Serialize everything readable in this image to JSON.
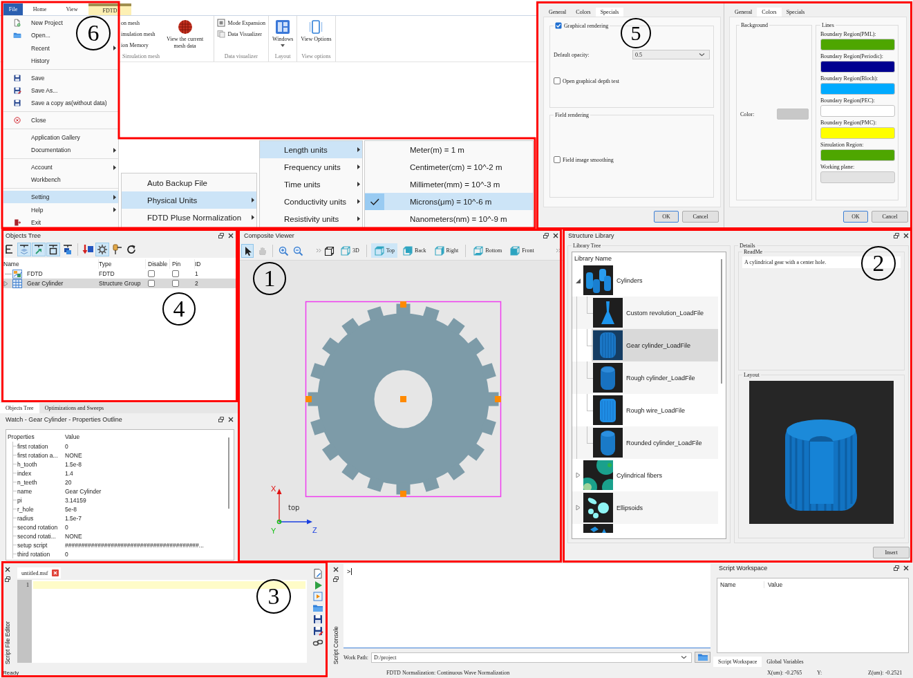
{
  "ribbon": {
    "tabs": [
      {
        "label": "File",
        "selected": true,
        "contextual": false
      },
      {
        "label": "Home",
        "selected": false,
        "contextual": false
      },
      {
        "label": "View",
        "selected": false,
        "contextual": false
      },
      {
        "label": "FDTD",
        "selected": false,
        "contextual": true
      }
    ],
    "groups": [
      {
        "label": "Simulation mesh",
        "items": [
          {
            "kind": "text",
            "label": "on mesh"
          },
          {
            "kind": "text",
            "label": "imulation mesh"
          },
          {
            "kind": "text",
            "label": "ion Memory"
          },
          {
            "kind": "large",
            "label": "View the current mesh data",
            "dropdown": false
          }
        ]
      },
      {
        "label": "Data visualizer",
        "items": [
          {
            "kind": "small",
            "label": "Mode Expansion"
          },
          {
            "kind": "small",
            "label": "Data Visualizer"
          }
        ]
      },
      {
        "label": "Layout",
        "items": [
          {
            "kind": "large",
            "label": "Windows",
            "dropdown": true
          }
        ]
      },
      {
        "label": "View options",
        "items": [
          {
            "kind": "large",
            "label": "View Options",
            "dropdown": false
          }
        ]
      }
    ]
  },
  "file_menu": {
    "sections": [
      {
        "items": [
          {
            "label": "New Project",
            "submenu": false,
            "selected": false
          },
          {
            "label": "Open...",
            "submenu": false,
            "selected": false
          },
          {
            "label": "Recent",
            "submenu": true,
            "selected": false
          },
          {
            "label": "History",
            "submenu": false,
            "selected": false
          }
        ]
      },
      {
        "items": [
          {
            "label": "Save",
            "submenu": false,
            "selected": false
          },
          {
            "label": "Save As...",
            "submenu": false,
            "selected": false
          },
          {
            "label": "Save a copy as(without data)",
            "submenu": false,
            "selected": false
          }
        ]
      },
      {
        "items": [
          {
            "label": "Close",
            "submenu": false,
            "selected": false
          }
        ]
      },
      {
        "items": [
          {
            "label": "Application Gallery",
            "submenu": false,
            "selected": false
          },
          {
            "label": "Documentation",
            "submenu": true,
            "selected": false
          }
        ]
      },
      {
        "items": [
          {
            "label": "Account",
            "submenu": true,
            "selected": false
          },
          {
            "label": "Workbench",
            "submenu": false,
            "selected": false
          }
        ]
      },
      {
        "items": [
          {
            "label": "Setting",
            "submenu": true,
            "selected": true
          },
          {
            "label": "Help",
            "submenu": true,
            "selected": false
          },
          {
            "label": "Exit",
            "submenu": false,
            "selected": false
          }
        ]
      }
    ]
  },
  "setting_menu": {
    "items": [
      {
        "label": "Auto Backup File",
        "submenu": false,
        "selected": false
      },
      {
        "label": "Physical Units",
        "submenu": true,
        "selected": true
      },
      {
        "label": "FDTD Pluse Normalization",
        "submenu": true,
        "selected": false
      }
    ]
  },
  "units_menu": {
    "items": [
      {
        "label": "Length units",
        "submenu": true,
        "selected": true
      },
      {
        "label": "Frequency units",
        "submenu": true,
        "selected": false
      },
      {
        "label": "Time units",
        "submenu": true,
        "selected": false
      },
      {
        "label": "Conductivity units",
        "submenu": true,
        "selected": false
      },
      {
        "label": "Resistivity units",
        "submenu": true,
        "selected": false
      }
    ]
  },
  "length_menu": {
    "items": [
      {
        "label": "Meter(m) = 1 m",
        "checked": false,
        "selected": false
      },
      {
        "label": "Centimeter(cm) = 10^-2 m",
        "checked": false,
        "selected": false
      },
      {
        "label": "Millimeter(mm) = 10^-3 m",
        "checked": false,
        "selected": false
      },
      {
        "label": "Microns(μm) = 10^-6 m",
        "checked": true,
        "selected": true
      },
      {
        "label": "Nanometers(nm) = 10^-9 m",
        "checked": false,
        "selected": false
      }
    ]
  },
  "specials_dialog": {
    "tabs": [
      {
        "label": "General",
        "selected": false
      },
      {
        "label": "Colors",
        "selected": false
      },
      {
        "label": "Specials",
        "selected": true
      }
    ],
    "graphical_rendering": {
      "label": "Graphical rendering",
      "checked": true
    },
    "opacity": {
      "label": "Default opacity:",
      "value": "0.5"
    },
    "depth_test": {
      "label": "Open graphical depth test",
      "checked": false
    },
    "field_rendering": {
      "title": "Field rendering"
    },
    "smoothing": {
      "label": "Field image smoothing",
      "checked": false
    },
    "buttons": [
      {
        "label": "OK",
        "default": true
      },
      {
        "label": "Cancel",
        "default": false
      }
    ]
  },
  "colors_dialog": {
    "tabs": [
      {
        "label": "General",
        "selected": false
      },
      {
        "label": "Colors",
        "selected": true
      },
      {
        "label": "Specials",
        "selected": false
      }
    ],
    "background": {
      "title": "Background",
      "label": "Color:",
      "color": "#c8c8c8"
    },
    "lines": {
      "title": "Lines",
      "items": [
        {
          "label": "Boundary Region(PML):",
          "color": "#4ea600"
        },
        {
          "label": "Boundary Region(Periodic):",
          "color": "#000090"
        },
        {
          "label": "Boundary Region(Bloch):",
          "color": "#00aaff"
        },
        {
          "label": "Boundary Region(PEC):",
          "color": "#ffffff"
        },
        {
          "label": "Boundary Region(PMC):",
          "color": "#ffff00"
        },
        {
          "label": "Simulation Region:",
          "color": "#4ea600"
        },
        {
          "label": "Working plane:",
          "color": "#e3e3e3"
        }
      ]
    },
    "buttons": [
      {
        "label": "OK",
        "default": true
      },
      {
        "label": "Cancel",
        "default": false
      }
    ]
  },
  "objects_tree": {
    "title": "Objects Tree",
    "toolbar": [
      {
        "on": false
      },
      {
        "on": true
      },
      {
        "on": true
      },
      {
        "on": true
      },
      {
        "on": false
      },
      {
        "on": false
      },
      {
        "on": true
      },
      {
        "on": false
      },
      {
        "on": false
      }
    ],
    "columns": [
      "Name",
      "Type",
      "Disable",
      "Pin",
      "ID"
    ],
    "rows": [
      {
        "name": "FDTD",
        "type": "FDTD",
        "disabled": false,
        "pinned": false,
        "id": "1",
        "selected": false,
        "expandable": false
      },
      {
        "name": "Gear Cylinder",
        "type": "Structure Group",
        "disabled": false,
        "pinned": false,
        "id": "2",
        "selected": true,
        "expandable": true
      }
    ]
  },
  "properties_panel": {
    "tabs": [
      {
        "label": "Objects Tree",
        "selected": true
      },
      {
        "label": "Optimizations and Sweeps",
        "selected": false
      }
    ],
    "title": "Watch - Gear Cylinder - Properties Outline",
    "columns": [
      "Properties",
      "Value"
    ],
    "rows": [
      {
        "name": "first rotation",
        "value": "0"
      },
      {
        "name": "first rotation a...",
        "value": "NONE"
      },
      {
        "name": "h_tooth",
        "value": "1.5e-8"
      },
      {
        "name": "index",
        "value": "1.4"
      },
      {
        "name": "n_teeth",
        "value": "20"
      },
      {
        "name": "name",
        "value": "Gear Cylinder"
      },
      {
        "name": "pi",
        "value": "3.14159"
      },
      {
        "name": "r_hole",
        "value": "5e-8"
      },
      {
        "name": "radius",
        "value": "1.5e-7"
      },
      {
        "name": "second rotation",
        "value": "0"
      },
      {
        "name": "second rotati...",
        "value": "NONE"
      },
      {
        "name": "setup script",
        "value": "#########################################..."
      },
      {
        "name": "third rotation",
        "value": "0"
      }
    ]
  },
  "composite_viewer": {
    "title": "Composite Viewer",
    "tools": [
      {
        "selected": true,
        "disabled": false
      },
      {
        "selected": false,
        "disabled": true
      },
      {
        "selected": false,
        "disabled": false
      },
      {
        "selected": false,
        "disabled": false
      }
    ],
    "views": [
      {
        "label": "3D",
        "selected": false
      },
      {
        "label": "Top",
        "selected": true
      },
      {
        "label": "Back",
        "selected": false
      },
      {
        "label": "Right",
        "selected": false
      },
      {
        "label": "Bottom",
        "selected": false
      },
      {
        "label": "Front",
        "selected": false
      }
    ],
    "axes": {
      "vertical": "X",
      "depth": "Y",
      "horizontal": "Z",
      "view_label": "top"
    }
  },
  "structure_library": {
    "title": "Structure Library",
    "tree_title": "Library Tree",
    "column": "Library Name",
    "items": [
      {
        "label": "Cylinders",
        "expanded": true,
        "selected": false,
        "children": [
          {
            "label": "Custom revolution_LoadFile",
            "selected": false
          },
          {
            "label": "Gear cylinder_LoadFile",
            "selected": true
          },
          {
            "label": "Rough cylinder_LoadFile",
            "selected": false
          },
          {
            "label": "Rough wire_LoadFile",
            "selected": false
          },
          {
            "label": "Rounded cylinder_LoadFile",
            "selected": false
          }
        ]
      },
      {
        "label": "Cylindrical fibers",
        "expanded": false,
        "selected": false
      },
      {
        "label": "Ellipsoids",
        "expanded": false,
        "selected": false
      },
      {
        "selected": false
      }
    ],
    "details_title": "Details",
    "readme_title": "ReadMe",
    "readme": "A cylindrical gear with a center hole.",
    "layout_title": "Layout",
    "insert": "Insert"
  },
  "script_editor": {
    "title": "Script File Editor",
    "tab": "untitled.msf",
    "line_numbers": [
      "1"
    ]
  },
  "script_console": {
    "title": "Script Console",
    "prompt": ">",
    "work_path_label": "Work Path:",
    "work_path": "D:/project"
  },
  "script_workspace": {
    "title": "Script Workspace",
    "columns": [
      "Name",
      "Value"
    ],
    "tabs": [
      {
        "label": "Script Workspace",
        "selected": true
      },
      {
        "label": "Global Variables",
        "selected": false
      }
    ]
  },
  "status_bar": {
    "state": "Ready",
    "message": "FDTD Normalization: Continuous Wave Normalization",
    "x": "X(um): -0.2765",
    "y": "Y:",
    "z": "Z(um): -0.2521"
  },
  "annotations": [
    {
      "number": "6"
    },
    {
      "number": "5"
    },
    {
      "number": "4"
    },
    {
      "number": "1"
    },
    {
      "number": "2"
    },
    {
      "number": "3"
    }
  ]
}
